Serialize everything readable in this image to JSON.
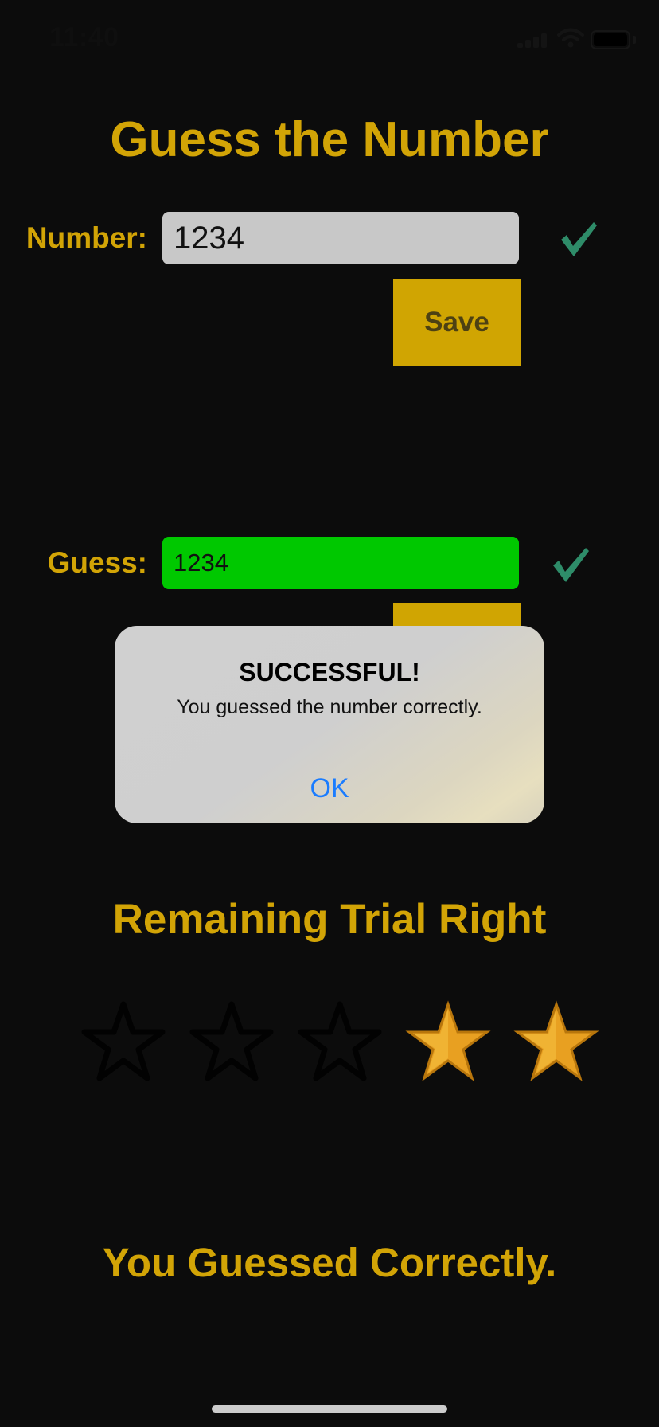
{
  "status_bar": {
    "time": "11:40",
    "icons": [
      "signal-icon",
      "wifi-icon",
      "battery-icon"
    ]
  },
  "app": {
    "title": "Guess the Number",
    "number_label": "Number:",
    "number_value": "1234",
    "save_label": "Save",
    "guess_label": "Guess:",
    "guess_value": "1234",
    "guess_button_label": "",
    "remaining_title": "Remaining Trial Right",
    "remaining_stars": {
      "total": 5,
      "filled": 2
    },
    "result_text": "You Guessed Correctly."
  },
  "alert": {
    "title": "SUCCESSFUL!",
    "message": "You guessed the number correctly.",
    "ok_label": "OK"
  },
  "colors": {
    "background": "#0c0c0c",
    "accent_gold": "#d2a406",
    "button_gold": "#d0a502",
    "guess_field_green": "#00c800",
    "check_green": "#2e8c69",
    "alert_button_blue": "#1a7cff",
    "star_gold": "#e8a021"
  }
}
